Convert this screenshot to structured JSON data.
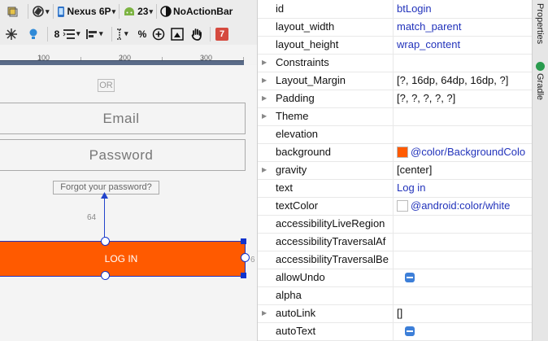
{
  "toolbar": {
    "device": "Nexus 6P",
    "api": "23",
    "theme": "NoActionBar",
    "dp_label": "8",
    "percent": "%",
    "error_count": "7"
  },
  "ruler": {
    "labels": [
      "100",
      "200",
      "300"
    ]
  },
  "canvas": {
    "or_text": "OR",
    "email_hint": "Email",
    "password_hint": "Password",
    "forgot_text": "Forgot your password?",
    "margin_value": "64",
    "login_text": "LOG IN",
    "side_margin": "6"
  },
  "properties": [
    {
      "name": "id",
      "value": "btLogin",
      "expandable": false
    },
    {
      "name": "layout_width",
      "value": "match_parent",
      "expandable": false
    },
    {
      "name": "layout_height",
      "value": "wrap_content",
      "expandable": false
    },
    {
      "name": "Constraints",
      "value": "",
      "expandable": true
    },
    {
      "name": "Layout_Margin",
      "value": "[?, 16dp, 64dp, 16dp, ?]",
      "expandable": true,
      "black": true
    },
    {
      "name": "Padding",
      "value": "[?, ?, ?, ?, ?]",
      "expandable": true,
      "black": true
    },
    {
      "name": "Theme",
      "value": "",
      "expandable": true
    },
    {
      "name": "elevation",
      "value": "",
      "expandable": false
    },
    {
      "name": "background",
      "value": "@color/BackgroundColo",
      "expandable": false,
      "swatch": "#ff5a00"
    },
    {
      "name": "gravity",
      "value": "[center]",
      "expandable": true,
      "black": true
    },
    {
      "name": "text",
      "value": "Log in",
      "expandable": false
    },
    {
      "name": "textColor",
      "value": "@android:color/white",
      "expandable": false,
      "swatch": "#ffffff"
    },
    {
      "name": "accessibilityLiveRegion",
      "value": "",
      "expandable": false
    },
    {
      "name": "accessibilityTraversalAf",
      "value": "",
      "expandable": false
    },
    {
      "name": "accessibilityTraversalBe",
      "value": "",
      "expandable": false
    },
    {
      "name": "allowUndo",
      "value": "",
      "expandable": false,
      "checkbox": true
    },
    {
      "name": "alpha",
      "value": "",
      "expandable": false
    },
    {
      "name": "autoLink",
      "value": "[]",
      "expandable": true,
      "black": true
    },
    {
      "name": "autoText",
      "value": "",
      "expandable": false,
      "checkbox": true
    }
  ],
  "side_tabs": {
    "properties": "Properties",
    "gradle": "Gradle"
  },
  "colors": {
    "button_bg": "#ff5a00",
    "selection": "#1133cc",
    "checkbox": "#3d7fd8"
  }
}
